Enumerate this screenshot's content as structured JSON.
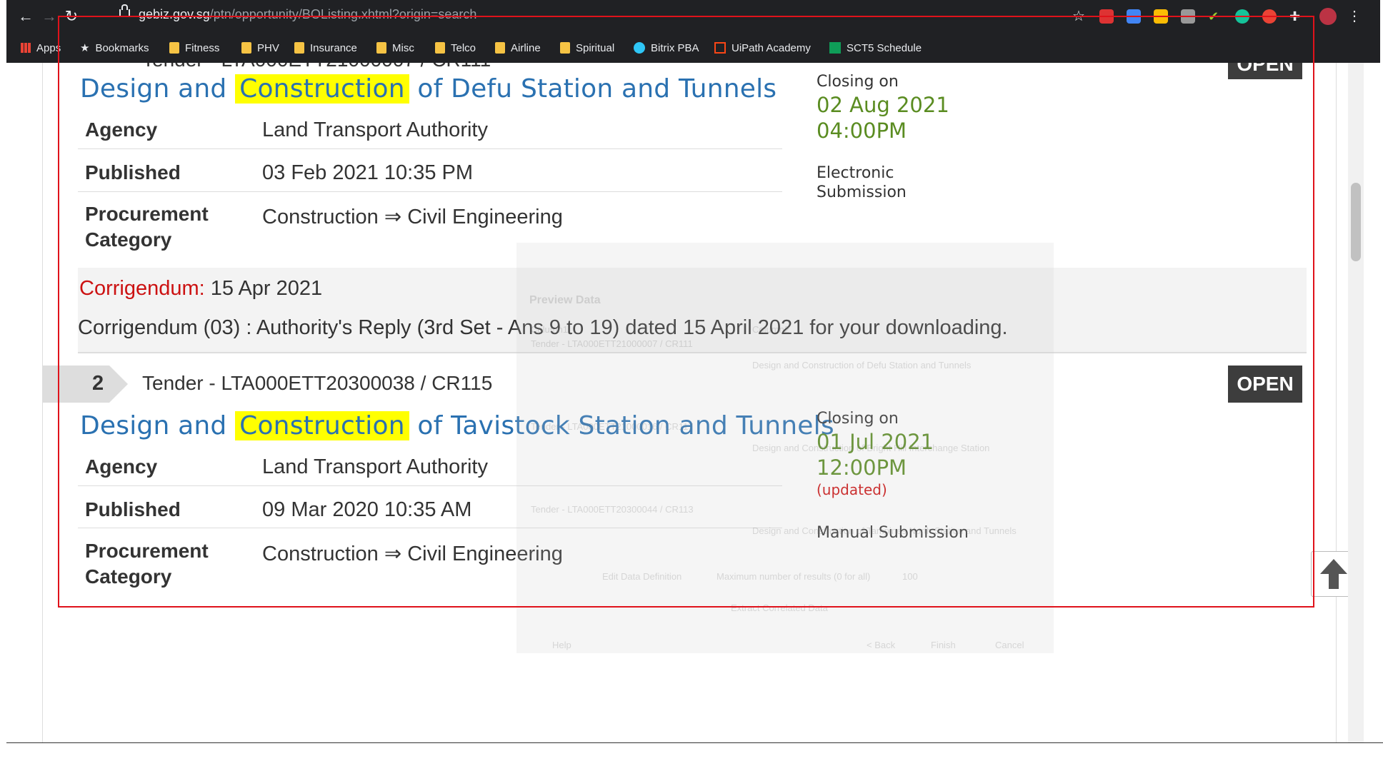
{
  "browser": {
    "url_host": "gebiz.gov.sg",
    "url_path": "/ptn/opportunity/BOListing.xhtml?origin=search",
    "bookmarks": [
      "Apps",
      "Bookmarks",
      "Fitness",
      "PHV",
      "Insurance",
      "Misc",
      "Telco",
      "Airline",
      "Spiritual",
      "Bitrix PBA",
      "UiPath Academy",
      "SCT5 Schedule"
    ]
  },
  "items": [
    {
      "tender_partial": "Tender - LTA000ETT21000007 / CR111",
      "status": "OPEN",
      "title_before": "Design and",
      "title_highlight": "Construction",
      "title_after": "of Defu Station and Tunnels",
      "agency_label": "Agency",
      "agency": "Land Transport Authority",
      "published_label": "Published",
      "published": "03 Feb 2021 10:35 PM",
      "procurement_label_1": "Procurement",
      "procurement_label_2": "Category",
      "procurement": "Construction ⇒ Civil Engineering",
      "closing_label": "Closing on",
      "closing_date": "02 Aug 2021",
      "closing_time": "04:00PM",
      "submission_1": "Electronic",
      "submission_2": "Submission",
      "corrigendum_label": "Corrigendum:",
      "corrigendum_date": "15 Apr 2021",
      "corrigendum_text": "Corrigendum (03) : Authority's Reply (3rd Set - Ans 9 to 19) dated 15 April 2021 for your downloading."
    },
    {
      "number": "2",
      "tender": "Tender - LTA000ETT20300038 / CR115",
      "status": "OPEN",
      "title_before": "Design and",
      "title_highlight": "Construction",
      "title_after": "of Tavistock Station and Tunnels",
      "agency_label": "Agency",
      "agency": "Land Transport Authority",
      "published_label": "Published",
      "published": "09 Mar 2020 10:35 AM",
      "procurement_label_1": "Procurement",
      "procurement_label_2": "Category",
      "procurement": "Construction ⇒ Civil Engineering",
      "closing_label": "Closing on",
      "closing_date": "01 Jul 2021",
      "closing_time": "12:00PM",
      "closing_note": "(updated)",
      "submission": "Manual Submission"
    }
  ],
  "overlay": {
    "title": "Preview Data",
    "col1": "Column1",
    "col2": "Column2",
    "rows": [
      "Tender - LTA000ETT21000007 / CR111",
      "Design and Construction of Defu Station and Tunnels",
      "Tender - LTA000ETT21000016 / CR117",
      "Design and Construction of Bright Hill Interchange Station",
      "Tender - LTA000ETT20300044 / CR113",
      "Design and Construction of Tampines North Station and Tunnels"
    ],
    "buttons": [
      "Edit Data Definition",
      "Maximum number of results (0 for all)",
      "100",
      "Extract Correlated Data",
      "Help",
      "< Back",
      "Finish",
      "Cancel"
    ]
  }
}
